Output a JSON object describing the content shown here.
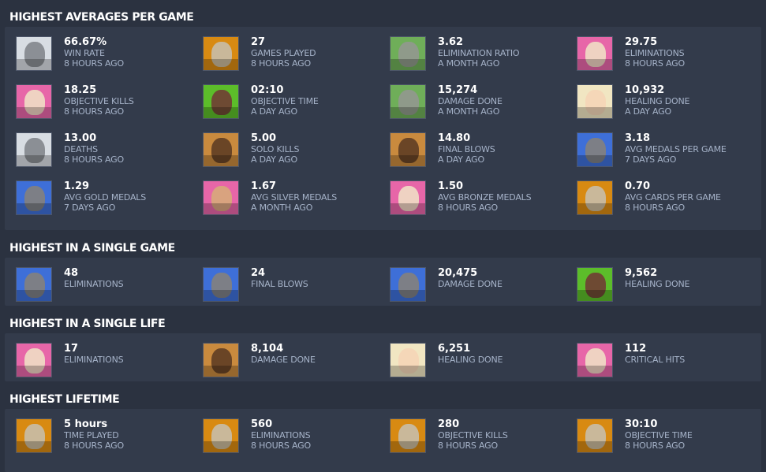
{
  "sections": [
    {
      "title": "HIGHEST AVERAGES PER GAME",
      "stats": [
        {
          "value": "66.67%",
          "label": "WIN RATE",
          "ago": "8 HOURS AGO",
          "hero_icon": "winston-icon",
          "bg": "#d8dde3",
          "face": "#8b8f95"
        },
        {
          "value": "27",
          "label": "GAMES PLAYED",
          "ago": "8 HOURS AGO",
          "hero_icon": "zenyatta-icon",
          "bg": "#d88a12",
          "face": "#c9b89a"
        },
        {
          "value": "3.62",
          "label": "ELIMINATION RATIO",
          "ago": "A MONTH AGO",
          "hero_icon": "bastion-icon",
          "bg": "#6fae59",
          "face": "#8f9a8a"
        },
        {
          "value": "29.75",
          "label": "ELIMINATIONS",
          "ago": "8 HOURS AGO",
          "hero_icon": "dva-icon",
          "bg": "#e766a8",
          "face": "#efd2c2"
        },
        {
          "value": "18.25",
          "label": "OBJECTIVE KILLS",
          "ago": "8 HOURS AGO",
          "hero_icon": "dva-icon",
          "bg": "#e766a8",
          "face": "#efd2c2"
        },
        {
          "value": "02:10",
          "label": "OBJECTIVE TIME",
          "ago": "A DAY AGO",
          "hero_icon": "lucio-icon",
          "bg": "#5cbd2a",
          "face": "#6e4a33"
        },
        {
          "value": "15,274",
          "label": "DAMAGE DONE",
          "ago": "A MONTH AGO",
          "hero_icon": "bastion-icon",
          "bg": "#6fae59",
          "face": "#8f9a8a"
        },
        {
          "value": "10,932",
          "label": "HEALING DONE",
          "ago": "A DAY AGO",
          "hero_icon": "mercy-icon",
          "bg": "#f1e6c2",
          "face": "#f5d7b8"
        },
        {
          "value": "13.00",
          "label": "DEATHS",
          "ago": "8 HOURS AGO",
          "hero_icon": "winston-icon",
          "bg": "#d8dde3",
          "face": "#8b8f95"
        },
        {
          "value": "5.00",
          "label": "SOLO KILLS",
          "ago": "A DAY AGO",
          "hero_icon": "junkrat-icon",
          "bg": "#c98a3e",
          "face": "#6a4526"
        },
        {
          "value": "14.80",
          "label": "FINAL BLOWS",
          "ago": "A DAY AGO",
          "hero_icon": "junkrat-icon",
          "bg": "#c98a3e",
          "face": "#6a4526"
        },
        {
          "value": "3.18",
          "label": "AVG MEDALS PER GAME",
          "ago": "7 DAYS AGO",
          "hero_icon": "soldier-76-icon",
          "bg": "#3e6fd8",
          "face": "#7d7f86"
        },
        {
          "value": "1.29",
          "label": "AVG GOLD MEDALS",
          "ago": "7 DAYS AGO",
          "hero_icon": "soldier-76-icon",
          "bg": "#3e6fd8",
          "face": "#7d7f86"
        },
        {
          "value": "1.67",
          "label": "AVG SILVER MEDALS",
          "ago": "A MONTH AGO",
          "hero_icon": "zarya-icon",
          "bg": "#e766a8",
          "face": "#d9a37f"
        },
        {
          "value": "1.50",
          "label": "AVG BRONZE MEDALS",
          "ago": "8 HOURS AGO",
          "hero_icon": "dva-icon",
          "bg": "#e766a8",
          "face": "#efd2c2"
        },
        {
          "value": "0.70",
          "label": "AVG CARDS PER GAME",
          "ago": "8 HOURS AGO",
          "hero_icon": "zenyatta-icon",
          "bg": "#d88a12",
          "face": "#c9b89a"
        }
      ]
    },
    {
      "title": "HIGHEST IN A SINGLE GAME",
      "stats": [
        {
          "value": "48",
          "label": "ELIMINATIONS",
          "ago": "",
          "hero_icon": "soldier-76-icon",
          "bg": "#3e6fd8",
          "face": "#7d7f86"
        },
        {
          "value": "24",
          "label": "FINAL BLOWS",
          "ago": "",
          "hero_icon": "soldier-76-icon",
          "bg": "#3e6fd8",
          "face": "#7d7f86"
        },
        {
          "value": "20,475",
          "label": "DAMAGE DONE",
          "ago": "",
          "hero_icon": "soldier-76-icon",
          "bg": "#3e6fd8",
          "face": "#7d7f86"
        },
        {
          "value": "9,562",
          "label": "HEALING DONE",
          "ago": "",
          "hero_icon": "lucio-icon",
          "bg": "#5cbd2a",
          "face": "#6e4a33"
        }
      ]
    },
    {
      "title": "HIGHEST IN A SINGLE LIFE",
      "stats": [
        {
          "value": "17",
          "label": "ELIMINATIONS",
          "ago": "",
          "hero_icon": "dva-icon",
          "bg": "#e766a8",
          "face": "#efd2c2"
        },
        {
          "value": "8,104",
          "label": "DAMAGE DONE",
          "ago": "",
          "hero_icon": "junkrat-icon",
          "bg": "#c98a3e",
          "face": "#6a4526"
        },
        {
          "value": "6,251",
          "label": "HEALING DONE",
          "ago": "",
          "hero_icon": "mercy-icon",
          "bg": "#f1e6c2",
          "face": "#f5d7b8"
        },
        {
          "value": "112",
          "label": "CRITICAL HITS",
          "ago": "",
          "hero_icon": "dva-icon",
          "bg": "#e766a8",
          "face": "#efd2c2"
        }
      ]
    },
    {
      "title": "HIGHEST LIFETIME",
      "stats": [
        {
          "value": "5 hours",
          "label": "TIME PLAYED",
          "ago": "8 HOURS AGO",
          "hero_icon": "zenyatta-icon",
          "bg": "#d88a12",
          "face": "#c9b89a"
        },
        {
          "value": "560",
          "label": "ELIMINATIONS",
          "ago": "8 HOURS AGO",
          "hero_icon": "zenyatta-icon",
          "bg": "#d88a12",
          "face": "#c9b89a"
        },
        {
          "value": "280",
          "label": "OBJECTIVE KILLS",
          "ago": "8 HOURS AGO",
          "hero_icon": "zenyatta-icon",
          "bg": "#d88a12",
          "face": "#c9b89a"
        },
        {
          "value": "30:10",
          "label": "OBJECTIVE TIME",
          "ago": "8 HOURS AGO",
          "hero_icon": "zenyatta-icon",
          "bg": "#d88a12",
          "face": "#c9b89a"
        }
      ]
    }
  ]
}
